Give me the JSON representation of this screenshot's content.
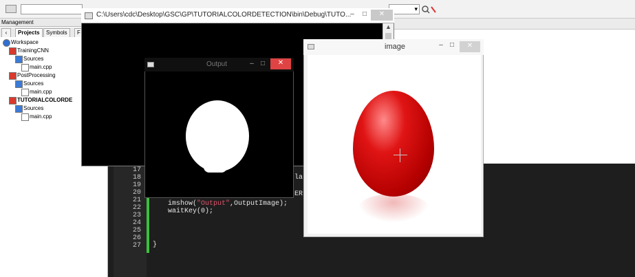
{
  "toolbar": {},
  "management": {
    "title": "Management",
    "tabs": [
      "Projects",
      "Symbols",
      "F"
    ],
    "tree": [
      {
        "label": "Workspace",
        "level": 0,
        "icon": "workspace-icon"
      },
      {
        "label": "TrainingCNN",
        "level": 1,
        "icon": "project-icon"
      },
      {
        "label": "Sources",
        "level": 2,
        "icon": "folder-icon"
      },
      {
        "label": "main.cpp",
        "level": 3,
        "icon": "file-icon"
      },
      {
        "label": "PostProcessing",
        "level": 1,
        "icon": "project-icon"
      },
      {
        "label": "Sources",
        "level": 2,
        "icon": "folder-icon"
      },
      {
        "label": "main.cpp",
        "level": 3,
        "icon": "file-icon"
      },
      {
        "label": "TUTORIALCOLORDE",
        "level": 1,
        "icon": "project-icon",
        "bold": true
      },
      {
        "label": "Sources",
        "level": 2,
        "icon": "folder-icon"
      },
      {
        "label": "main.cpp",
        "level": 3,
        "icon": "file-icon"
      }
    ]
  },
  "console_window": {
    "title": "C:\\Users\\cdc\\Desktop\\GSC\\GP\\TUTORIALCOLORDETECTION\\bin\\Debug\\TUTO...",
    "minimize": "–",
    "maximize": "□",
    "close": "✕"
  },
  "output_window": {
    "title": "Output",
    "minimize": "–",
    "maximize": "□",
    "close": "✕"
  },
  "image_window": {
    "title": "image",
    "minimize": "–",
    "maximize": "□",
    "close": "✕"
  },
  "editor": {
    "line_numbers": [
      "17",
      "18",
      "19",
      "20",
      "21",
      "22",
      "23",
      "24",
      "25",
      "26",
      "27"
    ],
    "code": {
      "line21_prefix": "imshow(",
      "line21_string": "\"Output\"",
      "line21_suffix": ",OutputImage);",
      "line22": "waitKey(0);",
      "line26": "}",
      "frag_18": "la",
      "frag_20": "ER"
    }
  },
  "colors": {
    "egg_red": "#d81414",
    "editor_bg": "#1e1e1e",
    "change_bar": "#3dbf3d",
    "close_button": "#e04343"
  }
}
